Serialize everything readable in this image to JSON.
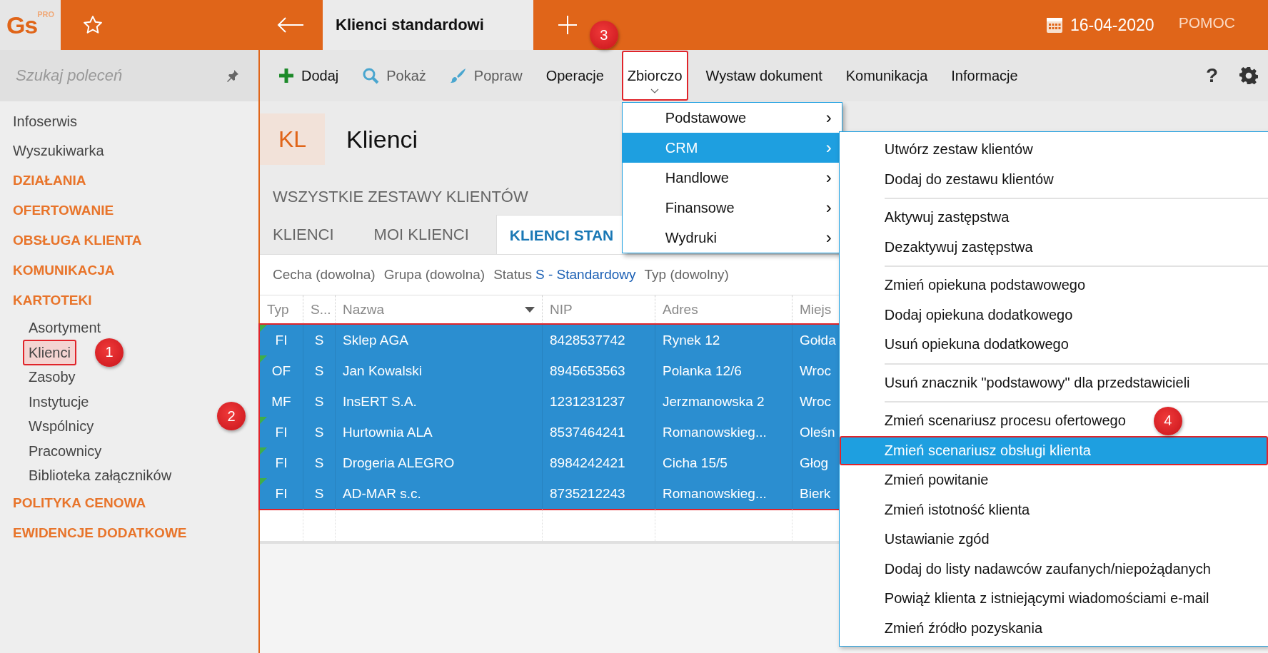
{
  "app": {
    "logo": "Gs",
    "logo_badge": "PRO"
  },
  "top_bar": {
    "tabs": [
      {
        "label": "Klienci standardowi",
        "selected": true
      }
    ],
    "date": "16-04-2020",
    "help": "POMOC"
  },
  "sidebar": {
    "search": {
      "placeholder": "Szukaj poleceń"
    },
    "items": [
      {
        "label": "Infoserwis",
        "kind": "link"
      },
      {
        "label": "Wyszukiwarka",
        "kind": "link"
      },
      {
        "label": "DZIAŁANIA",
        "kind": "section"
      },
      {
        "label": "OFERTOWANIE",
        "kind": "section"
      },
      {
        "label": "OBSŁUGA KLIENTA",
        "kind": "section"
      },
      {
        "label": "KOMUNIKACJA",
        "kind": "section"
      },
      {
        "label": "KARTOTEKI",
        "kind": "section",
        "children": [
          {
            "label": "Asortyment",
            "selected": false,
            "highlighted": false
          },
          {
            "label": "Klienci",
            "selected": true,
            "highlighted": true,
            "callout": "1"
          },
          {
            "label": "Zasoby",
            "selected": false,
            "highlighted": false
          },
          {
            "label": "Instytucje",
            "selected": false,
            "highlighted": false
          },
          {
            "label": "Wspólnicy",
            "selected": false,
            "highlighted": false
          },
          {
            "label": "Pracownicy",
            "selected": false,
            "highlighted": false
          },
          {
            "label": "Biblioteka załączników",
            "selected": false,
            "highlighted": false
          }
        ]
      },
      {
        "label": "POLITYKA CENOWA",
        "kind": "section"
      },
      {
        "label": "EWIDENCJE DODATKOWE",
        "kind": "section"
      }
    ]
  },
  "toolbar": {
    "buttons": [
      {
        "label": "Dodaj",
        "kind": "add",
        "disabled": false,
        "selected": false
      },
      {
        "label": "Pokaż",
        "kind": "show",
        "disabled": true,
        "selected": false
      },
      {
        "label": "Popraw",
        "kind": "edit",
        "disabled": true,
        "selected": false
      },
      {
        "label": "Operacje",
        "kind": "plain",
        "disabled": false,
        "selected": false
      },
      {
        "label": "Zbiorczo",
        "kind": "plain",
        "disabled": false,
        "selected": true,
        "highlighted": true,
        "callout": "3"
      },
      {
        "label": "Wystaw dokument",
        "kind": "plain",
        "disabled": false,
        "selected": false
      },
      {
        "label": "Komunikacja",
        "kind": "plain",
        "disabled": false,
        "selected": false
      },
      {
        "label": "Informacje",
        "kind": "plain",
        "disabled": false,
        "selected": false
      }
    ],
    "help": "?"
  },
  "page": {
    "code": "KL",
    "title": "Klienci",
    "section": "WSZYSTKIE ZESTAWY KLIENTÓW",
    "tabs": [
      {
        "label": "KLIENCI",
        "selected": false
      },
      {
        "label": "MOI KLIENCI",
        "selected": false
      },
      {
        "label": "KLIENCI STAN",
        "selected": true
      }
    ],
    "filters": [
      {
        "label": "Cecha (dowolna)"
      },
      {
        "label": "Grupa (dowolna)"
      },
      {
        "label": "Status",
        "value": "S - Standardowy"
      },
      {
        "label": "Typ (dowolny)"
      }
    ]
  },
  "table": {
    "highlighted": true,
    "callout": "2",
    "columns": [
      {
        "label": "Typ",
        "sorted": false
      },
      {
        "label": "S...",
        "sorted": false
      },
      {
        "label": "Nazwa",
        "sorted": true
      },
      {
        "label": "NIP",
        "sorted": false
      },
      {
        "label": "Adres",
        "sorted": false
      },
      {
        "label": "Miejs",
        "sorted": false
      }
    ],
    "rows": [
      {
        "selected": true,
        "flag": true,
        "cells": [
          "FI",
          "S",
          "Sklep AGA",
          "8428537742",
          "Rynek 12",
          "Gołda"
        ]
      },
      {
        "selected": true,
        "flag": true,
        "cells": [
          "OF",
          "S",
          "Jan Kowalski",
          "8945653563",
          "Polanka  12/6",
          "Wroc"
        ]
      },
      {
        "selected": true,
        "flag": false,
        "cells": [
          "MF",
          "S",
          "InsERT S.A.",
          "1231231237",
          "Jerzmanowska 2",
          "Wroc"
        ]
      },
      {
        "selected": true,
        "flag": true,
        "cells": [
          "FI",
          "S",
          "Hurtownia ALA",
          "8537464241",
          "Romanowskieg...",
          "Oleśn"
        ]
      },
      {
        "selected": true,
        "flag": true,
        "cells": [
          "FI",
          "S",
          "Drogeria ALEGRO",
          "8984242421",
          "Cicha  15/5",
          "Głog"
        ]
      },
      {
        "selected": true,
        "flag": true,
        "cells": [
          "FI",
          "S",
          "AD-MAR s.c.",
          "8735212243",
          "Romanowskieg...",
          "Bierk"
        ]
      }
    ]
  },
  "dropdown": {
    "items": [
      {
        "label": "Podstawowe",
        "arrow": "›",
        "selected": false
      },
      {
        "label": "CRM",
        "arrow": "›",
        "selected": true
      },
      {
        "label": "Handlowe",
        "arrow": "›",
        "selected": false
      },
      {
        "label": "Finansowe",
        "arrow": "›",
        "selected": false
      },
      {
        "label": "Wydruki",
        "arrow": "›",
        "selected": false
      }
    ]
  },
  "submenu": {
    "groups": [
      {
        "items": [
          {
            "label": "Utwórz zestaw klientów",
            "selected": false
          },
          {
            "label": "Dodaj do zestawu klientów",
            "selected": false
          }
        ]
      },
      {
        "items": [
          {
            "label": "Aktywuj zastępstwa",
            "selected": false
          },
          {
            "label": "Dezaktywuj zastępstwa",
            "selected": false
          }
        ]
      },
      {
        "items": [
          {
            "label": "Zmień opiekuna podstawowego",
            "selected": false
          },
          {
            "label": "Dodaj opiekuna dodatkowego",
            "selected": false
          },
          {
            "label": "Usuń opiekuna dodatkowego",
            "selected": false
          }
        ]
      },
      {
        "items": [
          {
            "label": "Usuń znacznik \"podstawowy\" dla przedstawicieli",
            "selected": false
          }
        ]
      },
      {
        "items": [
          {
            "label": "Zmień scenariusz procesu ofertowego",
            "selected": false
          },
          {
            "label": "Zmień scenariusz obsługi klienta",
            "selected": true,
            "highlighted": true,
            "callout": "4"
          },
          {
            "label": "Zmień powitanie",
            "selected": false
          },
          {
            "label": "Zmień istotność klienta",
            "selected": false
          },
          {
            "label": "Ustawianie zgód",
            "selected": false
          },
          {
            "label": "Dodaj do listy nadawców zaufanych/niepożądanych",
            "selected": false
          },
          {
            "label": "Powiąż klienta z istniejącymi wiadomościami e-mail",
            "selected": false
          },
          {
            "label": "Zmień źródło pozyskania",
            "selected": false
          }
        ]
      }
    ]
  }
}
